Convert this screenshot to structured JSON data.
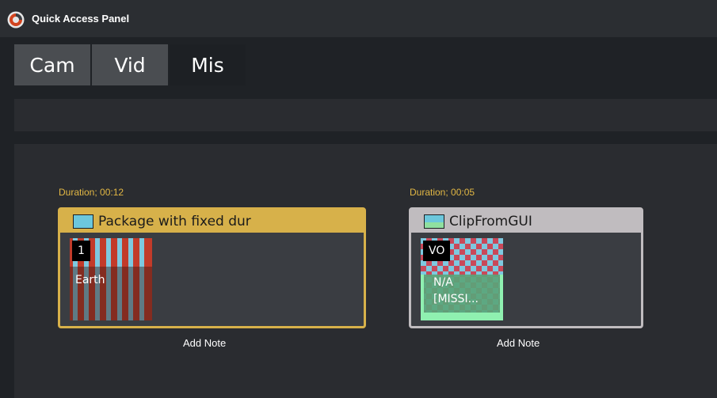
{
  "window": {
    "title": "Quick Access Panel",
    "logo_icon": "app-logo-icon"
  },
  "tabs": [
    {
      "label": "Cam",
      "active": false
    },
    {
      "label": "Vid",
      "active": false
    },
    {
      "label": "Mis",
      "active": true
    }
  ],
  "items": [
    {
      "duration": "Duration; 00:12",
      "title": "Package with fixed dur",
      "header_color": "#d7b14a",
      "thumbnail": {
        "badge": "1",
        "caption": "Earth"
      },
      "note_label": "Add Note"
    },
    {
      "duration": "Duration; 00:05",
      "title": "ClipFromGUI",
      "header_color": "#c0bcbf",
      "thumbnail": {
        "badge": "VO",
        "caption_line1": "N/A",
        "caption_line2": "[MISSI..."
      },
      "note_label": "Add Note"
    }
  ]
}
